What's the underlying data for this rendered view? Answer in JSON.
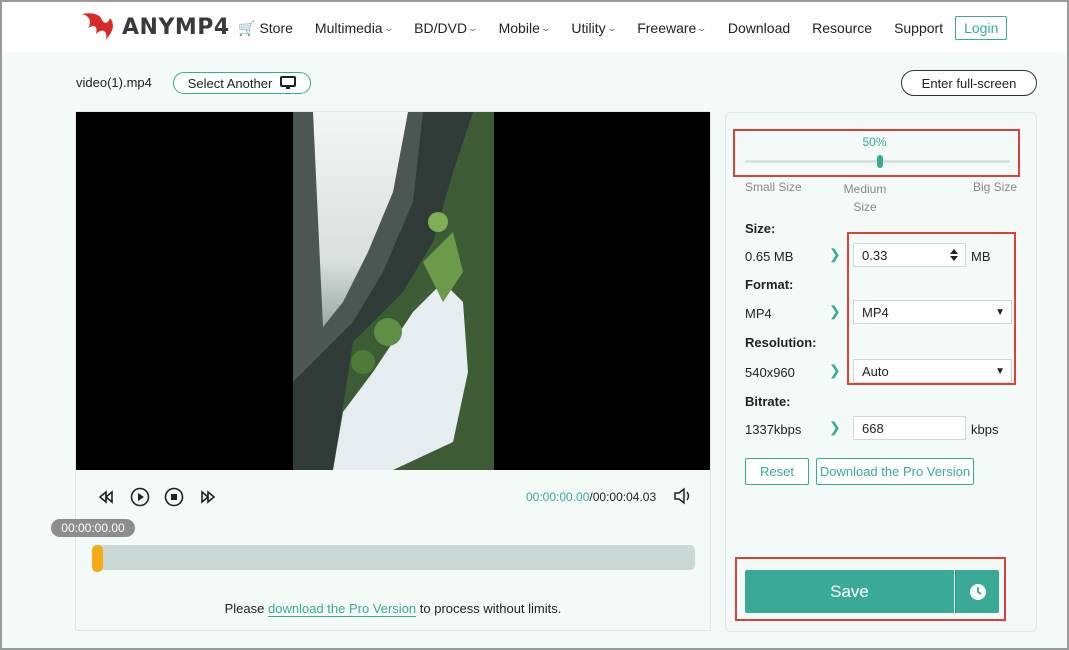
{
  "header": {
    "logo_text": "ANYMP4",
    "nav": [
      {
        "label": "Store"
      },
      {
        "label": "Multimedia"
      },
      {
        "label": "BD/DVD"
      },
      {
        "label": "Mobile"
      },
      {
        "label": "Utility"
      },
      {
        "label": "Freeware"
      },
      {
        "label": "Download"
      },
      {
        "label": "Resource"
      },
      {
        "label": "Support"
      }
    ],
    "login_label": "Login"
  },
  "toolbar": {
    "filename": "video(1).mp4",
    "select_another_label": "Select Another",
    "fullscreen_label": "Enter full-screen"
  },
  "player": {
    "current_time": "00:00:00.00",
    "total_time": "/00:00:04.03",
    "bubble_time": "00:00:00.00",
    "progress": 0
  },
  "pro_note": {
    "prefix": "Please ",
    "link": "download the Pro Version",
    "suffix": " to process without limits."
  },
  "compress": {
    "percent_label": "50%",
    "slider_value": 0.5,
    "small_label": "Small Size",
    "medium_label": "Medium Size",
    "big_label": "Big Size",
    "size_label": "Size:",
    "size_original": "0.65 MB",
    "size_value": "0.33",
    "size_unit": "MB",
    "format_label": "Format:",
    "format_original": "MP4",
    "format_value": "MP4",
    "resolution_label": "Resolution:",
    "resolution_original": "540x960",
    "resolution_value": "Auto",
    "bitrate_label": "Bitrate:",
    "bitrate_original": "1337kbps",
    "bitrate_value": "668",
    "bitrate_unit": "kbps",
    "reset_label": "Reset",
    "download_pro_label": "Download the Pro Version",
    "save_label": "Save"
  },
  "colors": {
    "accent": "#3aaa97",
    "highlight_box": "#d9413b",
    "handle": "#f5a916"
  }
}
